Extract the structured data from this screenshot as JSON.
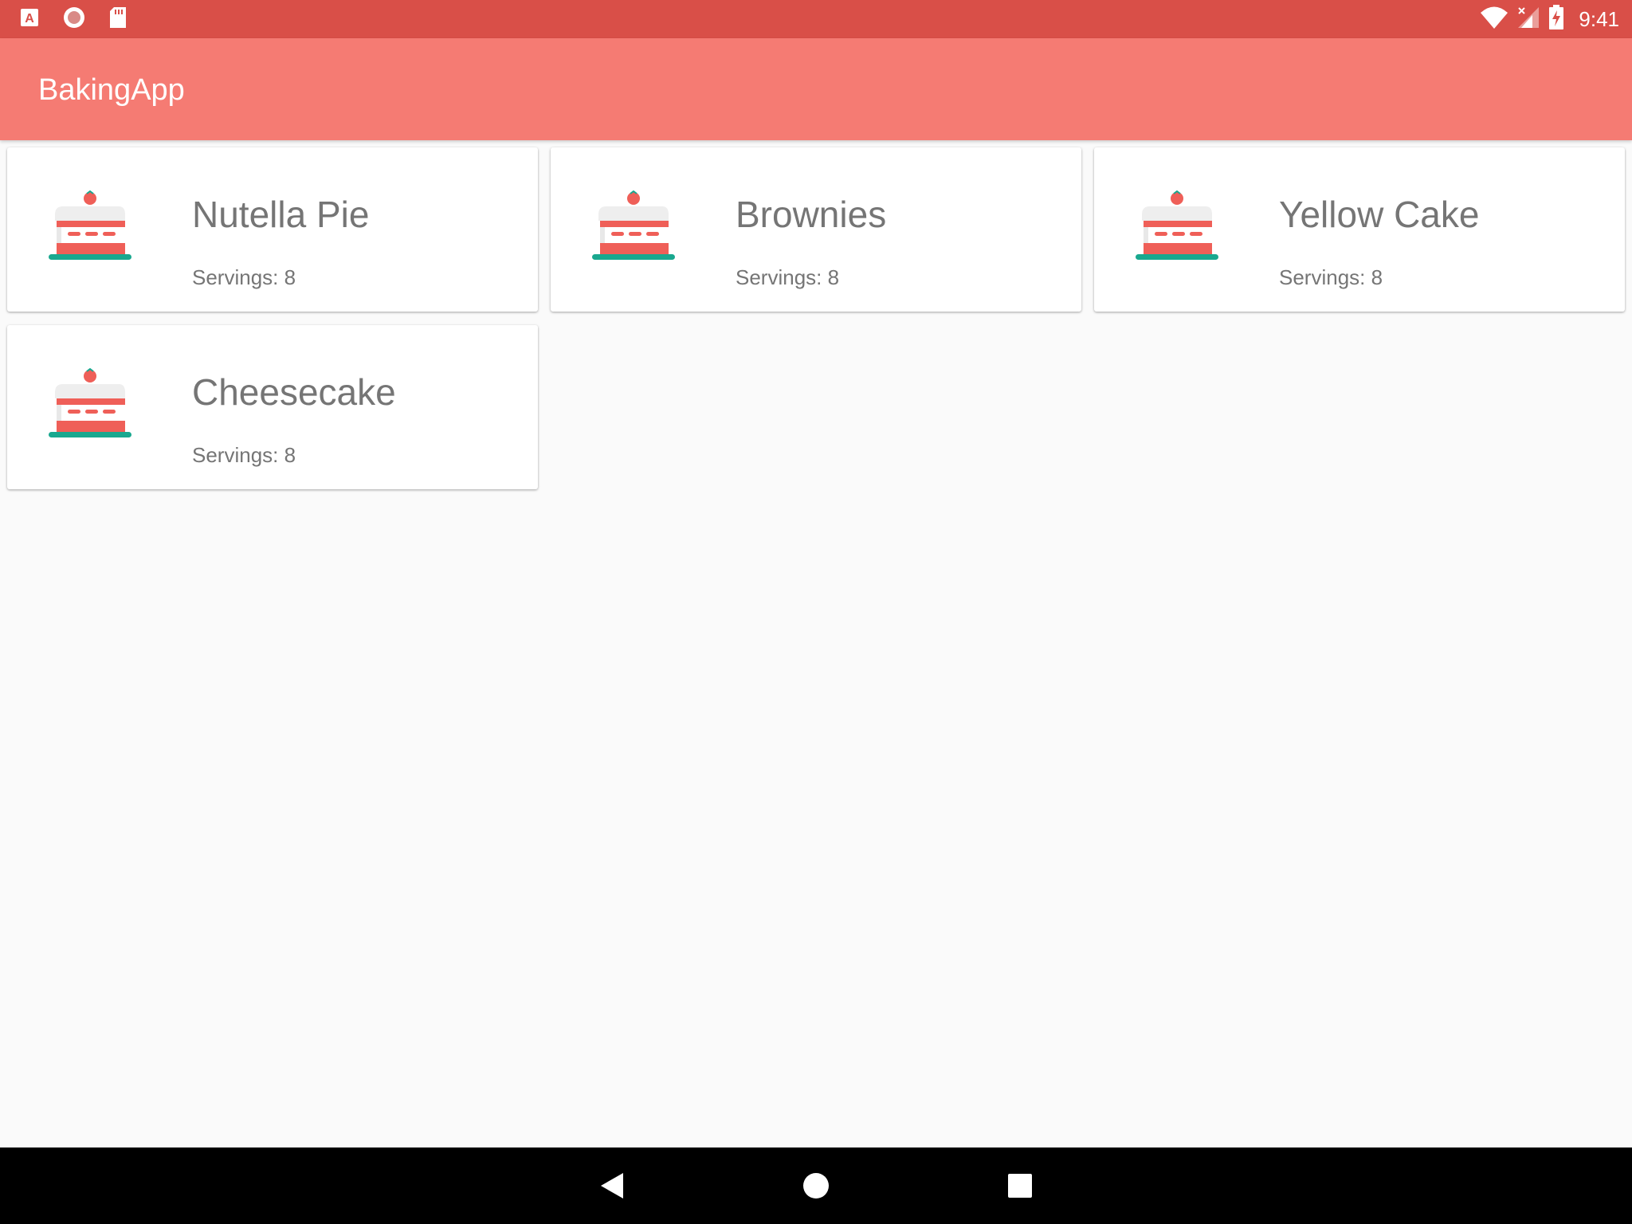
{
  "status_bar": {
    "time": "9:41",
    "left_icons": [
      "text-a-icon",
      "record-icon",
      "sd-card-icon"
    ],
    "right_icons": [
      "wifi-icon",
      "signal-icon",
      "battery-charging-icon"
    ]
  },
  "app_bar": {
    "title": "BakingApp"
  },
  "recipes": [
    {
      "name": "Nutella Pie",
      "servings": "Servings: 8",
      "icon": "cake-icon"
    },
    {
      "name": "Brownies",
      "servings": "Servings: 8",
      "icon": "cake-icon"
    },
    {
      "name": "Yellow Cake",
      "servings": "Servings: 8",
      "icon": "cake-icon"
    },
    {
      "name": "Cheesecake",
      "servings": "Servings: 8",
      "icon": "cake-icon"
    }
  ],
  "nav_bar": {
    "buttons": [
      "back-icon",
      "home-icon",
      "recents-icon"
    ]
  },
  "colors": {
    "status_bar": "#d94f48",
    "app_bar": "#f57b73",
    "card_text": "#757575",
    "cake_red": "#ef5f58",
    "cake_plate": "#19a88f"
  }
}
